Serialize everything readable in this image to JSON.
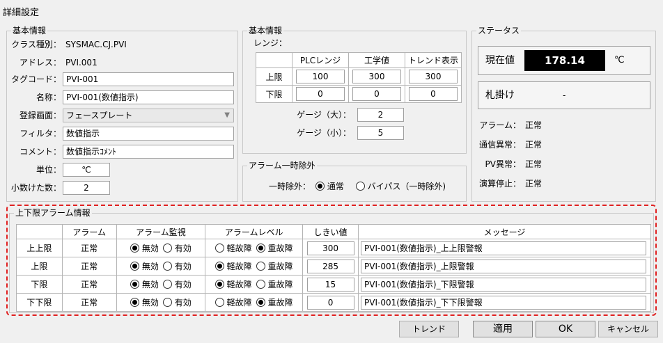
{
  "window": {
    "title": "詳細設定"
  },
  "basic_info": {
    "legend": "基本情報",
    "rows": [
      {
        "label": "クラス種別：",
        "value": "SYSMAC.CJ.PVI",
        "kind": "static"
      },
      {
        "label": "アドレス：",
        "value": "PVI.001",
        "kind": "static"
      },
      {
        "label": "タグコード：",
        "value": "PVI-001",
        "kind": "input"
      },
      {
        "label": "名称：",
        "value": "PVI-001(数値指示)",
        "kind": "input"
      },
      {
        "label": "登録画面：",
        "value": "フェースプレート",
        "kind": "combo"
      },
      {
        "label": "フィルタ：",
        "value": "数値指示",
        "kind": "input"
      },
      {
        "label": "コメント：",
        "value": "数値指示ｺﾒﾝﾄ",
        "kind": "input"
      }
    ],
    "unit_label": "単位：",
    "unit_value": "℃",
    "decimals_label": "小数けた数：",
    "decimals_value": "2"
  },
  "range_info": {
    "legend": "基本情報",
    "range_label": "レンジ：",
    "columns": [
      "PLCレンジ",
      "工学値",
      "トレンド表示"
    ],
    "rows": [
      {
        "name": "上限",
        "values": [
          "100",
          "300",
          "300"
        ]
      },
      {
        "name": "下限",
        "values": [
          "0",
          "0",
          "0"
        ]
      }
    ],
    "gauge_large_label": "ゲージ（大）：",
    "gauge_large_value": "2",
    "gauge_small_label": "ゲージ（小）：",
    "gauge_small_value": "5"
  },
  "alarm_exclusion": {
    "legend": "アラーム一時除外",
    "label": "一時除外：",
    "options": [
      "通常",
      "バイパス（一時除外)"
    ],
    "selected": 0
  },
  "status": {
    "legend": "ステータス",
    "current_label": "現在値",
    "current_value": "178.14",
    "unit": "℃",
    "tag_label": "札掛け",
    "tag_value": "-",
    "items": [
      {
        "label": "アラーム：",
        "value": "正常"
      },
      {
        "label": "通信異常：",
        "value": "正常"
      },
      {
        "label": "PV異常：",
        "value": "正常"
      },
      {
        "label": "演算停止：",
        "value": "正常"
      }
    ],
    "colors": {
      "value_bg": "#000000",
      "value_fg": "#ffffff"
    }
  },
  "alarm_limits": {
    "legend": "上下限アラーム情報",
    "headers": [
      "",
      "アラーム",
      "アラーム監視",
      "アラームレベル",
      "しきい値",
      "メッセージ"
    ],
    "monitor_options": [
      "無効",
      "有効"
    ],
    "level_options": [
      "軽故障",
      "重故障"
    ],
    "rows": [
      {
        "name": "上上限",
        "alarm": "正常",
        "monitor": 0,
        "level": 1,
        "threshold": "300",
        "message": "PVI-001(数値指示)_上上限警報"
      },
      {
        "name": "上限",
        "alarm": "正常",
        "monitor": 0,
        "level": 0,
        "threshold": "285",
        "message": "PVI-001(数値指示)_上限警報"
      },
      {
        "name": "下限",
        "alarm": "正常",
        "monitor": 0,
        "level": 0,
        "threshold": "15",
        "message": "PVI-001(数値指示)_下限警報"
      },
      {
        "name": "下下限",
        "alarm": "正常",
        "monitor": 0,
        "level": 1,
        "threshold": "0",
        "message": "PVI-001(数値指示)_下下限警報"
      }
    ],
    "highlight_color": "#e02020"
  },
  "buttons": {
    "trend": "トレンド",
    "apply": "適用",
    "ok": "OK",
    "cancel": "キャンセル"
  }
}
